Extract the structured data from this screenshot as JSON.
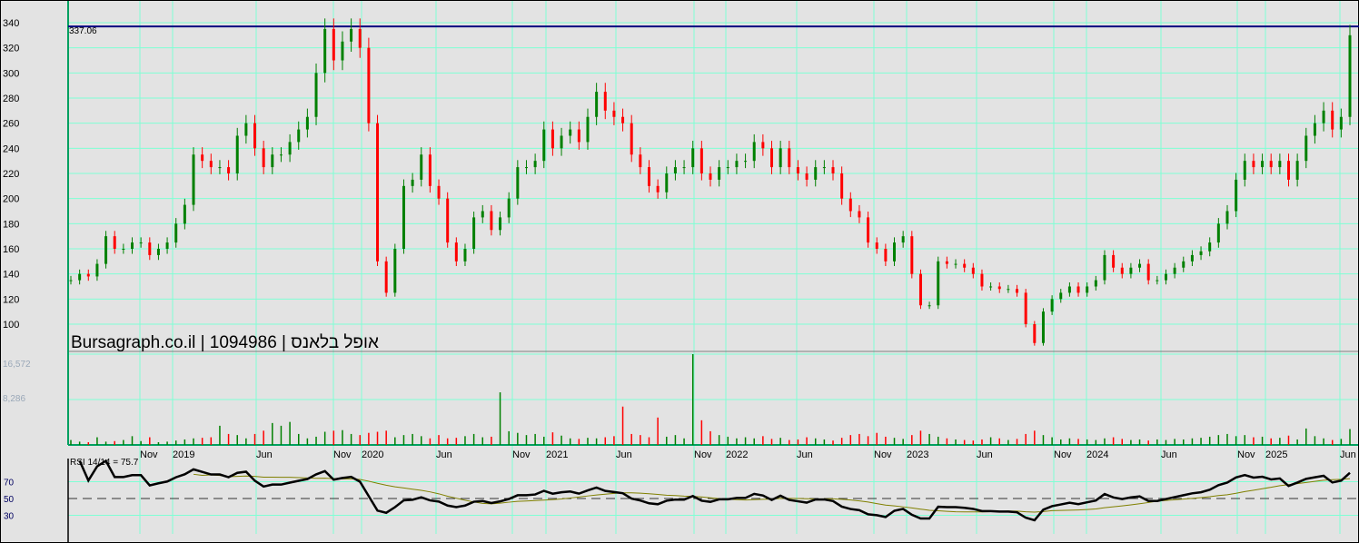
{
  "chart_data": {
    "type": "candlestick",
    "title": "Bursagraph.co.il | 1094986 | אופל בלאנס",
    "last_price_line": 337.06,
    "last_price_label": "337.06",
    "price_axis": {
      "ticks": [
        100,
        120,
        140,
        160,
        180,
        200,
        220,
        240,
        260,
        280,
        300,
        320,
        340
      ],
      "ylim": [
        100,
        340
      ]
    },
    "x_ticks": [
      "Nov",
      "2019",
      "Jun",
      "Nov",
      "2020",
      "Jun",
      "Nov",
      "2021",
      "Jun",
      "Nov",
      "2022",
      "Jun",
      "Nov",
      "2023",
      "Jun",
      "Nov",
      "2024",
      "Jun",
      "Nov",
      "2025",
      "Jun"
    ],
    "closes": [
      135,
      140,
      138,
      148,
      170,
      160,
      160,
      165,
      165,
      155,
      160,
      165,
      180,
      195,
      235,
      230,
      225,
      225,
      220,
      250,
      260,
      240,
      225,
      235,
      235,
      245,
      255,
      265,
      300,
      335,
      310,
      325,
      335,
      320,
      260,
      150,
      125,
      160,
      210,
      215,
      235,
      210,
      200,
      165,
      150,
      160,
      185,
      190,
      175,
      185,
      200,
      225,
      225,
      230,
      255,
      240,
      250,
      255,
      245,
      265,
      285,
      270,
      265,
      260,
      235,
      225,
      210,
      205,
      220,
      225,
      225,
      240,
      220,
      215,
      225,
      225,
      230,
      230,
      245,
      240,
      225,
      240,
      225,
      220,
      215,
      225,
      225,
      220,
      200,
      190,
      185,
      165,
      160,
      150,
      165,
      170,
      140,
      115,
      115,
      150,
      148,
      148,
      145,
      140,
      130,
      130,
      128,
      128,
      125,
      100,
      85,
      110,
      120,
      125,
      130,
      125,
      130,
      135,
      155,
      145,
      140,
      145,
      148,
      135,
      135,
      140,
      145,
      150,
      155,
      158,
      165,
      180,
      190,
      215,
      230,
      225,
      230,
      225,
      230,
      215,
      230,
      250,
      260,
      270,
      255,
      265,
      330
    ],
    "volume": {
      "tick_labels": [
        "16,572",
        "8,286"
      ],
      "ticks": [
        16572,
        8286
      ],
      "values": [
        900,
        600,
        500,
        1400,
        600,
        700,
        900,
        1600,
        700,
        1400,
        500,
        600,
        800,
        1000,
        1200,
        1300,
        1400,
        3500,
        2000,
        1800,
        1200,
        2000,
        2600,
        4000,
        3500,
        4200,
        2000,
        1200,
        1500,
        2400,
        2600,
        2700,
        2000,
        1800,
        2200,
        2400,
        2600,
        1400,
        1800,
        2000,
        1600,
        1200,
        1800,
        1200,
        1300,
        1600,
        2000,
        1400,
        1500,
        9600,
        2500,
        2200,
        1800,
        2000,
        1500,
        2300,
        1700,
        1200,
        1100,
        1300,
        1200,
        1400,
        1600,
        7000,
        2000,
        1800,
        1400,
        5000,
        1500,
        1800,
        1200,
        16572,
        4500,
        2500,
        1800,
        1500,
        1200,
        1400,
        1200,
        1600,
        1100,
        1300,
        900,
        1000,
        1400,
        1200,
        1000,
        800,
        1300,
        1800,
        2000,
        1600,
        2200,
        1500,
        1300,
        1100,
        1800,
        2600,
        2000,
        1500,
        1200,
        1000,
        900,
        800,
        1000,
        1400,
        1200,
        900,
        1100,
        2000,
        2600,
        1800,
        1400,
        1000,
        1200,
        1100,
        1000,
        900,
        1200,
        1400,
        1100,
        900,
        1000,
        800,
        1000,
        900,
        1100,
        1000,
        1200,
        1300,
        1500,
        1800,
        2000,
        1600,
        1800,
        1400,
        1500,
        1200,
        1300,
        1700,
        1000,
        3000,
        1600,
        1200,
        900,
        1100,
        2900
      ]
    },
    "rsi": {
      "label": "RSI 14/14 = 75.7",
      "period": 14,
      "ma_period": 14,
      "ticks": [
        70,
        50,
        30
      ],
      "tick_labels": [
        "70",
        "50",
        "30"
      ],
      "mid_line": 50,
      "current": 75.7
    },
    "colors": {
      "up": "#008000",
      "down": "#ff0000",
      "grid": "#7fffd4",
      "last_line": "#000080",
      "rsi": "#000000",
      "rsi_ma": "#808000",
      "mid": "#cc0000"
    }
  }
}
